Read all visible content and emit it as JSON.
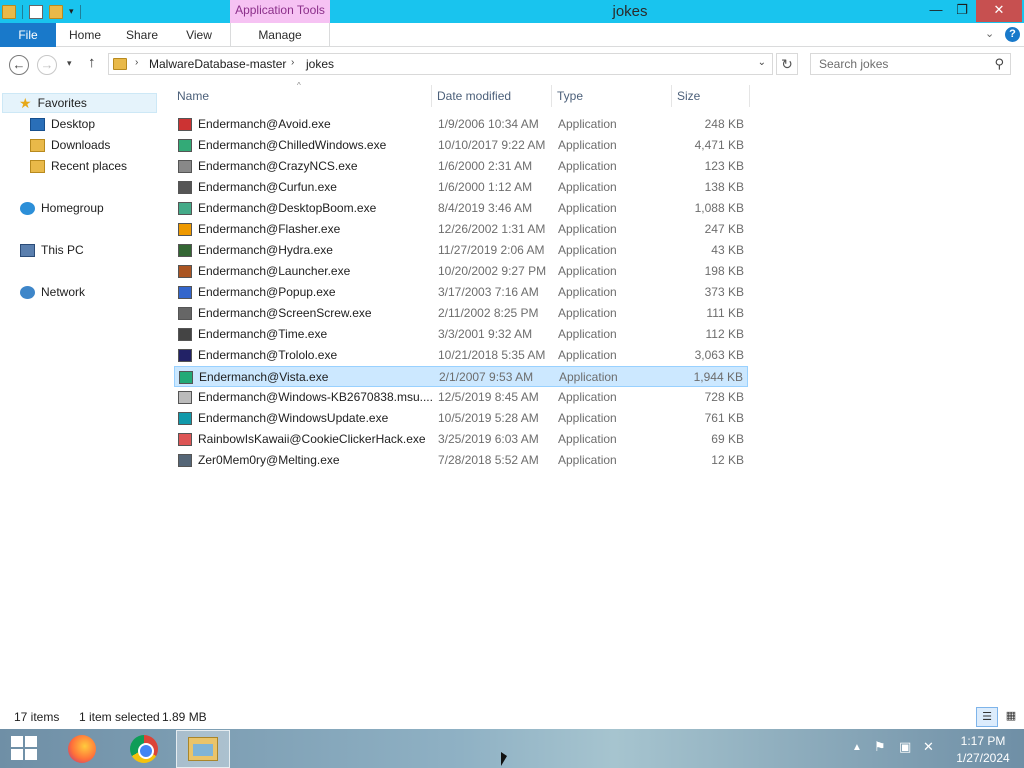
{
  "window": {
    "title": "jokes",
    "context_tab": "Application Tools",
    "controls": {
      "minimize": "—",
      "maximize": "❐",
      "close": "✕"
    }
  },
  "ribbon": {
    "tabs": [
      "File",
      "Home",
      "Share",
      "View",
      "Manage"
    ],
    "collapse_icon": "⌄",
    "help_icon": "?"
  },
  "navigation": {
    "back": "←",
    "forward": "→",
    "recent": "▾",
    "up": "↑",
    "breadcrumb": [
      "MalwareDatabase-master",
      "jokes"
    ],
    "crumb_sep": "›",
    "address_dropdown": "⌄",
    "refresh": "↻",
    "search_placeholder": "Search jokes",
    "search_icon": "⚲"
  },
  "nav_pane": {
    "favorites": "Favorites",
    "desktop": "Desktop",
    "downloads": "Downloads",
    "recent": "Recent places",
    "homegroup": "Homegroup",
    "this_pc": "This PC",
    "network": "Network"
  },
  "columns": {
    "name": "Name",
    "date": "Date modified",
    "type": "Type",
    "size": "Size",
    "sort_icon": "^"
  },
  "files": [
    {
      "name": "Endermanch@Avoid.exe",
      "date": "1/9/2006 10:34 AM",
      "type": "Application",
      "size": "248 KB"
    },
    {
      "name": "Endermanch@ChilledWindows.exe",
      "date": "10/10/2017 9:22 AM",
      "type": "Application",
      "size": "4,471 KB"
    },
    {
      "name": "Endermanch@CrazyNCS.exe",
      "date": "1/6/2000 2:31 AM",
      "type": "Application",
      "size": "123 KB"
    },
    {
      "name": "Endermanch@Curfun.exe",
      "date": "1/6/2000 1:12 AM",
      "type": "Application",
      "size": "138 KB"
    },
    {
      "name": "Endermanch@DesktopBoom.exe",
      "date": "8/4/2019 3:46 AM",
      "type": "Application",
      "size": "1,088 KB"
    },
    {
      "name": "Endermanch@Flasher.exe",
      "date": "12/26/2002 1:31 AM",
      "type": "Application",
      "size": "247 KB"
    },
    {
      "name": "Endermanch@Hydra.exe",
      "date": "11/27/2019 2:06 AM",
      "type": "Application",
      "size": "43 KB"
    },
    {
      "name": "Endermanch@Launcher.exe",
      "date": "10/20/2002 9:27 PM",
      "type": "Application",
      "size": "198 KB"
    },
    {
      "name": "Endermanch@Popup.exe",
      "date": "3/17/2003 7:16 AM",
      "type": "Application",
      "size": "373 KB"
    },
    {
      "name": "Endermanch@ScreenScrew.exe",
      "date": "2/11/2002 8:25 PM",
      "type": "Application",
      "size": "111 KB"
    },
    {
      "name": "Endermanch@Time.exe",
      "date": "3/3/2001 9:32 AM",
      "type": "Application",
      "size": "112 KB"
    },
    {
      "name": "Endermanch@Trololo.exe",
      "date": "10/21/2018 5:35 AM",
      "type": "Application",
      "size": "3,063 KB"
    },
    {
      "name": "Endermanch@Vista.exe",
      "date": "2/1/2007 9:53 AM",
      "type": "Application",
      "size": "1,944 KB"
    },
    {
      "name": "Endermanch@Windows-KB2670838.msu....",
      "date": "12/5/2019 8:45 AM",
      "type": "Application",
      "size": "728 KB"
    },
    {
      "name": "Endermanch@WindowsUpdate.exe",
      "date": "10/5/2019 5:28 AM",
      "type": "Application",
      "size": "761 KB"
    },
    {
      "name": "RainbowIsKawaii@CookieClickerHack.exe",
      "date": "3/25/2019 6:03 AM",
      "type": "Application",
      "size": "69 KB"
    },
    {
      "name": "Zer0Mem0ry@Melting.exe",
      "date": "7/28/2018 5:52 AM",
      "type": "Application",
      "size": "12 KB"
    }
  ],
  "status": {
    "item_count": "17 items",
    "selected": "1 item selected",
    "selected_size": "1.89 MB",
    "view_details_icon": "☰",
    "view_large_icon": "▦"
  },
  "taskbar": {
    "tray_up": "▲",
    "flag": "⚑",
    "net": "▣",
    "vol": "✕",
    "time": "1:17 PM",
    "date": "1/27/2024"
  }
}
